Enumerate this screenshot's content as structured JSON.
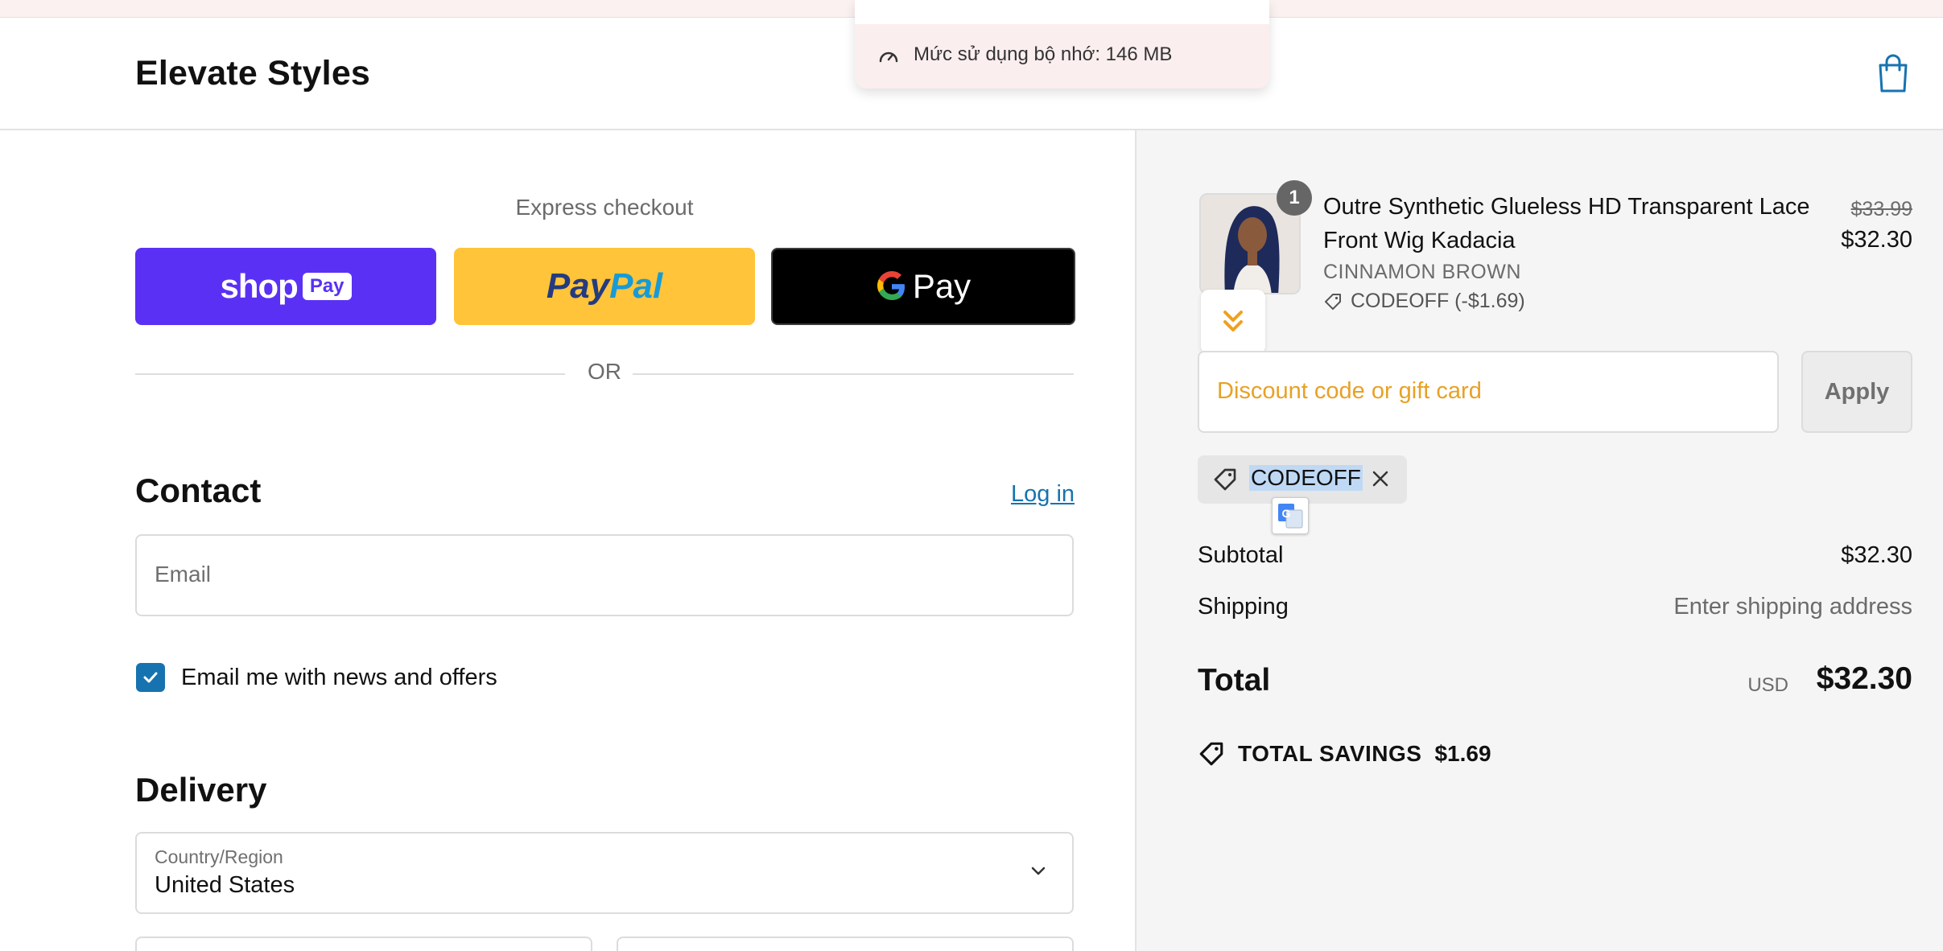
{
  "store": {
    "name": "Elevate Styles"
  },
  "memory_popup": {
    "text": "Mức sử dụng bộ nhớ: 146 MB"
  },
  "express": {
    "title": "Express checkout",
    "shop_pay": {
      "text": "shop",
      "badge": "Pay"
    },
    "paypal": {
      "part1": "Pay",
      "part2": "Pal"
    },
    "gpay": {
      "text": "Pay"
    },
    "or_label": "OR"
  },
  "contact": {
    "heading": "Contact",
    "login_label": "Log in",
    "email_placeholder": "Email",
    "newsletter_label": "Email me with news and offers",
    "newsletter_checked": true
  },
  "delivery": {
    "heading": "Delivery",
    "country_label": "Country/Region",
    "country_value": "United States"
  },
  "order": {
    "item": {
      "quantity": "1",
      "title": "Outre Synthetic Glueless HD Transparent Lace Front Wig Kadacia",
      "variant": "CINNAMON BROWN",
      "discount": "CODEOFF (-$1.69)",
      "original_price": "$33.99",
      "price": "$32.30"
    },
    "discount_placeholder": "Discount code or gift card",
    "apply_label": "Apply",
    "applied_code": "CODEOFF",
    "subtotal_label": "Subtotal",
    "subtotal_value": "$32.30",
    "shipping_label": "Shipping",
    "shipping_value": "Enter shipping address",
    "total_label": "Total",
    "total_currency": "USD",
    "total_value": "$32.30",
    "savings_label": "TOTAL SAVINGS",
    "savings_value": "$1.69"
  },
  "colors": {
    "shop_pay": "#5a31f4",
    "paypal": "#ffc439",
    "gpay": "#000000",
    "link": "#1773b0",
    "discount_placeholder": "#e8a125"
  }
}
